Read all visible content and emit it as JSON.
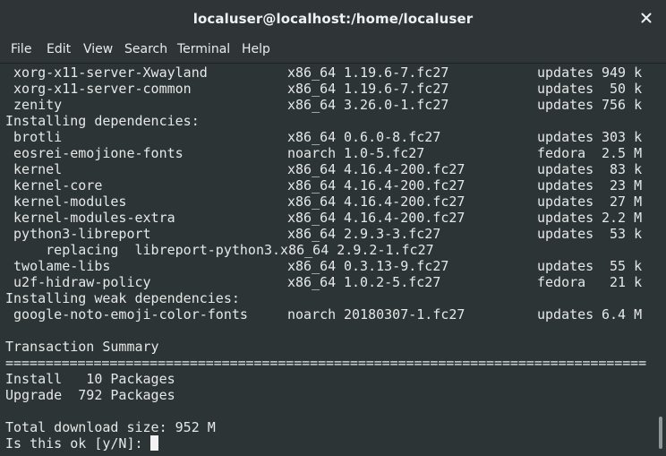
{
  "window": {
    "title": "localuser@localhost:/home/localuser",
    "close_symbol": "✕"
  },
  "menu": [
    {
      "label": "File"
    },
    {
      "label": "Edit"
    },
    {
      "label": "View"
    },
    {
      "label": "Search"
    },
    {
      "label": "Terminal"
    },
    {
      "label": "Help"
    }
  ],
  "terminal": {
    "rows": [
      {
        "name": " xorg-x11-server-Xwayland",
        "arch": "x86_64",
        "version": "1.19.6-7.fc27",
        "repo": "updates",
        "size": "949 k"
      },
      {
        "name": " xorg-x11-server-common",
        "arch": "x86_64",
        "version": "1.19.6-7.fc27",
        "repo": "updates",
        "size": " 50 k"
      },
      {
        "name": " zenity",
        "arch": "x86_64",
        "version": "3.26.0-1.fc27",
        "repo": "updates",
        "size": "756 k"
      },
      {
        "text": "Installing dependencies:"
      },
      {
        "name": " brotli",
        "arch": "x86_64",
        "version": "0.6.0-8.fc27",
        "repo": "updates",
        "size": "303 k"
      },
      {
        "name": " eosrei-emojione-fonts",
        "arch": "noarch",
        "version": "1.0-5.fc27",
        "repo": "fedora",
        "size": "2.5 M"
      },
      {
        "name": " kernel",
        "arch": "x86_64",
        "version": "4.16.4-200.fc27",
        "repo": "updates",
        "size": " 83 k"
      },
      {
        "name": " kernel-core",
        "arch": "x86_64",
        "version": "4.16.4-200.fc27",
        "repo": "updates",
        "size": " 23 M"
      },
      {
        "name": " kernel-modules",
        "arch": "x86_64",
        "version": "4.16.4-200.fc27",
        "repo": "updates",
        "size": " 27 M"
      },
      {
        "name": " kernel-modules-extra",
        "arch": "x86_64",
        "version": "4.16.4-200.fc27",
        "repo": "updates",
        "size": "2.2 M"
      },
      {
        "name": " python3-libreport",
        "arch": "x86_64",
        "version": "2.9.3-3.fc27",
        "repo": "updates",
        "size": " 53 k"
      },
      {
        "text": "     replacing  libreport-python3.x86_64 2.9.2-1.fc27"
      },
      {
        "name": " twolame-libs",
        "arch": "x86_64",
        "version": "0.3.13-9.fc27",
        "repo": "updates",
        "size": " 55 k"
      },
      {
        "name": " u2f-hidraw-policy",
        "arch": "x86_64",
        "version": "1.0.2-5.fc27",
        "repo": "fedora",
        "size": " 21 k"
      },
      {
        "text": "Installing weak dependencies:"
      },
      {
        "name": " google-noto-emoji-color-fonts",
        "arch": "noarch",
        "version": "20180307-1.fc27",
        "repo": "updates",
        "size": "6.4 M"
      },
      {
        "text": ""
      },
      {
        "text": "Transaction Summary"
      },
      {
        "text": "================================================================================"
      },
      {
        "text": "Install   10 Packages"
      },
      {
        "text": "Upgrade  792 Packages"
      },
      {
        "text": ""
      },
      {
        "text": "Total download size: 952 M"
      },
      {
        "text": "Is this ok [y/N]: "
      }
    ],
    "prompt_input": ""
  }
}
